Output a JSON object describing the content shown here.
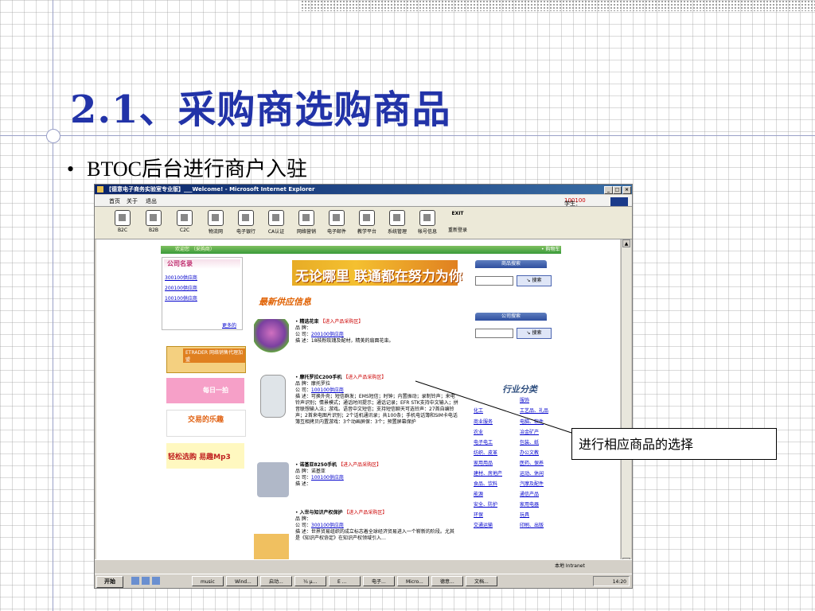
{
  "slide": {
    "title": "2.1、采购商选购商品",
    "bullet": "BTOC后台进行商户入驻",
    "callout": "进行相应商品的选择"
  },
  "window": {
    "title": "【德意电子商务实验室专业版】___Welcome! - Microsoft Internet Explorer",
    "menu": [
      "首页",
      "关于",
      "退出"
    ],
    "student_label": "学生：",
    "student_id": "100100",
    "toolbar": [
      "B2C",
      "B2B",
      "C2C",
      "物流网",
      "电子银行",
      "CA认证",
      "网络营销",
      "电子邮件",
      "教学平台",
      "系统管理",
      "帐号信息",
      "重新登录"
    ],
    "exit_label": "EXIT"
  },
  "page": {
    "welcome": "欢迎您 （采购商）",
    "cart": "• 购物车 •",
    "company_list_title": "公司名录",
    "companies": [
      "300100供应商",
      "200100供应商",
      "100100供应商"
    ],
    "more": "更多的",
    "ads": [
      "ETRADER 网络销售代理加盟",
      "每日一拍",
      "交易的乐趣",
      "轻松选购 易趣Mp3"
    ],
    "banner": "无论哪里 联通都在努力为你",
    "latest_title": "最新供应信息",
    "products": [
      {
        "name": "精选花束",
        "link": "【进入产品采购区】",
        "brand": "品 牌：",
        "company": "公 司：",
        "company_link": "200100供应商",
        "desc": "描 述：18枝粉玫瑰及配材，精美的扇面花束。"
      },
      {
        "name": "摩托罗拉C200手机",
        "link": "【进入产品采购区】",
        "brand": "品 牌：摩托罗拉",
        "company": "公 司：",
        "company_link": "100100供应商",
        "desc": "描 述：可换外壳；短信群发；EMS短信；时钟；内置振动；录制铃声；来电铃声识别；情景模式；通话时间提示；通话记录；EFR STK支持中文输入；拼音联想输入法；游戏。语音中文短信；支持短信聊天可选铃声：27首自编铃声；2首来电图片识别；2个话机通讯录；共100条；手机电话簿和SIM卡电话簿互相拷贝内置游戏：3个动画屏保：3个；预置屏幕保护"
      },
      {
        "name": "诺基亚8250手机",
        "link": "【进入产品采购区】",
        "brand": "品 牌：诺基亚",
        "company": "公 司：",
        "company_link": "100100供应商",
        "desc": "描 述："
      },
      {
        "name": "入世与知识产权保护",
        "link": "【进入产品采购区】",
        "brand": "品 牌：",
        "company": "公 司：",
        "company_link": "300100供应商",
        "desc": "描 述：世界贸易组织的成立标志着全球经济贸易进入一个崭新的阶段。尤其是《知识产权协定》在知识产权领域引入…"
      }
    ],
    "product_search_title": "商品搜索",
    "company_search_title": "公司搜索",
    "search_button": "搜索",
    "industry_title": "行业分类",
    "industries_left": [
      "",
      "化工",
      "商业服务",
      "农业",
      "电子电工",
      "纺织、皮革",
      "家用用品",
      "建材、房地产",
      "食品、饮料",
      "能源",
      "安全、防护",
      "环保",
      "交通运输"
    ],
    "industries_right": [
      "服饰",
      "工艺品、礼品",
      "电脑、软件",
      "冶金矿产",
      "包装、纸",
      "办公文教",
      "医药、保养",
      "运动、休闲",
      "汽摩及配件",
      "通信产品",
      "家用电器",
      "玩具",
      "印刷、出版"
    ]
  },
  "status": {
    "zone": "本地 Intranet"
  },
  "taskbar": {
    "start": "开始",
    "tasks": [
      "music",
      "Wind...",
      "启动...",
      "¼ µ...",
      "E ...",
      "电子...",
      "Micro...",
      "德意...",
      "文档..."
    ],
    "time": "14:20"
  }
}
